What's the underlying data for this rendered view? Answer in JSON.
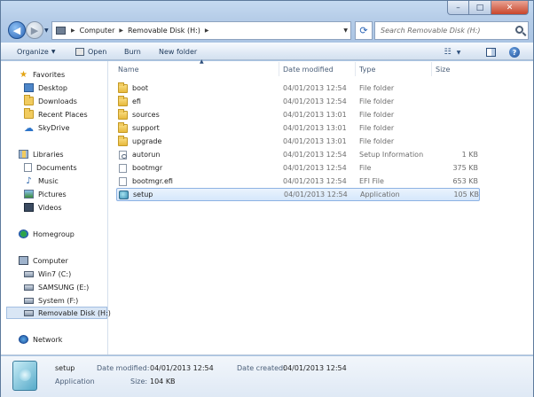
{
  "window": {
    "caption_buttons": [
      "–",
      "□",
      "✕"
    ]
  },
  "address": {
    "crumbs": [
      "Computer",
      "Removable Disk (H:)"
    ],
    "search_placeholder": "Search Removable Disk (H:)"
  },
  "toolbar": {
    "organize": "Organize",
    "open": "Open",
    "burn": "Burn",
    "new_folder": "New folder"
  },
  "nav": {
    "favorites": "Favorites",
    "desktop": "Desktop",
    "downloads": "Downloads",
    "recent_places": "Recent Places",
    "skydrive": "SkyDrive",
    "libraries": "Libraries",
    "documents": "Documents",
    "music": "Music",
    "pictures": "Pictures",
    "videos": "Videos",
    "homegroup": "Homegroup",
    "computer": "Computer",
    "win7": "Win7 (C:)",
    "samsung": "SAMSUNG (E:)",
    "system": "System (F:)",
    "removable": "Removable Disk (H:)",
    "network": "Network"
  },
  "columns": {
    "name": "Name",
    "date": "Date modified",
    "type": "Type",
    "size": "Size"
  },
  "files": [
    {
      "name": "boot",
      "date": "04/01/2013 12:54",
      "type": "File folder",
      "size": ""
    },
    {
      "name": "efi",
      "date": "04/01/2013 12:54",
      "type": "File folder",
      "size": ""
    },
    {
      "name": "sources",
      "date": "04/01/2013 13:01",
      "type": "File folder",
      "size": ""
    },
    {
      "name": "support",
      "date": "04/01/2013 13:01",
      "type": "File folder",
      "size": ""
    },
    {
      "name": "upgrade",
      "date": "04/01/2013 13:01",
      "type": "File folder",
      "size": ""
    },
    {
      "name": "autorun",
      "date": "04/01/2013 12:54",
      "type": "Setup Information",
      "size": "1 KB"
    },
    {
      "name": "bootmgr",
      "date": "04/01/2013 12:54",
      "type": "File",
      "size": "375 KB"
    },
    {
      "name": "bootmgr.efi",
      "date": "04/01/2013 12:54",
      "type": "EFI File",
      "size": "653 KB"
    },
    {
      "name": "setup",
      "date": "04/01/2013 12:54",
      "type": "Application",
      "size": "105 KB"
    }
  ],
  "details": {
    "name": "setup",
    "kind": "Application",
    "date_modified_label": "Date modified:",
    "date_modified": "04/01/2013 12:54",
    "date_created_label": "Date created:",
    "date_created": "04/01/2013 12:54",
    "size_label": "Size:",
    "size": "104 KB"
  }
}
